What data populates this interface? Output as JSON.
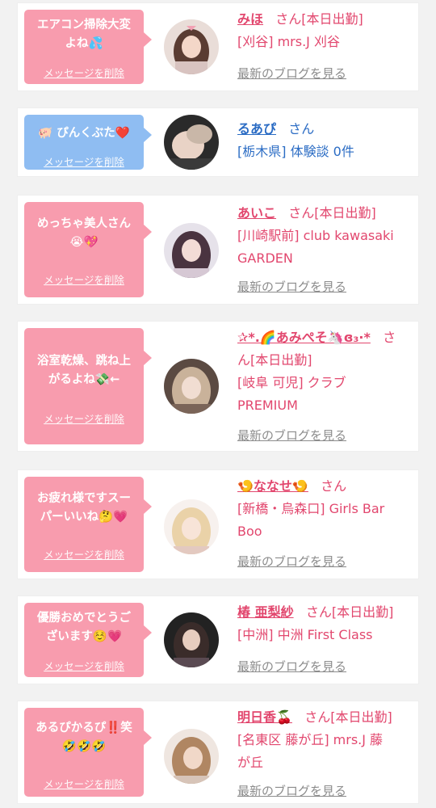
{
  "delete_label": "メッセージを削除",
  "blog_label": "最新のブログを見る",
  "cards": [
    {
      "message": "エアコン掃除大変\nよね💦",
      "name": "みほ",
      "suffix": "さん[本日出勤]",
      "shop": "[刈谷] mrs.J 刈谷",
      "bubble": "pink"
    },
    {
      "message": "🐖 ぴんくぶた❤️",
      "name": "るあぴ",
      "suffix": "さん",
      "shop": "[栃木県] 体験談 0件",
      "bubble": "blue"
    },
    {
      "message": "めっちゃ美人さん\n😭💖",
      "name": "あいこ",
      "suffix": "さん[本日出勤]",
      "shop": "[川崎駅前] club kawasaki\nGARDEN",
      "bubble": "pink"
    },
    {
      "message": "浴室乾燥、跳ね上\nがるよね💸←",
      "name": "✰*.🌈あみぺそ🦄ɞ₃·*",
      "suffix": "さ",
      "suffix2": "ん[本日出勤]",
      "shop": "[岐阜 可児] クラブ\nPREMIUM",
      "bubble": "pink"
    },
    {
      "message": "お疲れ様ですスー\nパーいいね🤔💗",
      "name": "🍤ななせ🍤",
      "suffix": "さん",
      "shop": "[新橋・烏森口] Girls Bar\nBoo",
      "bubble": "pink"
    },
    {
      "message": "優勝おめでとうご\nざいます☺️💗",
      "name": "椿 亜梨紗",
      "suffix": "さん[本日出勤]",
      "shop": "[中洲] 中洲 First Class",
      "bubble": "pink"
    },
    {
      "message": "あるぴかるぴ‼️笑\n🤣🤣🤣",
      "name": "明日香🍒",
      "suffix": "さん[本日出勤]",
      "shop": "[名東区 藤が丘] mrs.J 藤\nが丘",
      "bubble": "pink"
    }
  ],
  "colors": {
    "name_pink": "#e2476e",
    "name_blue": "#2b6cc4",
    "bubble_pink": "#f89cae",
    "bubble_blue": "#8fbdf2",
    "blog_gray": "#8c8c8c"
  }
}
